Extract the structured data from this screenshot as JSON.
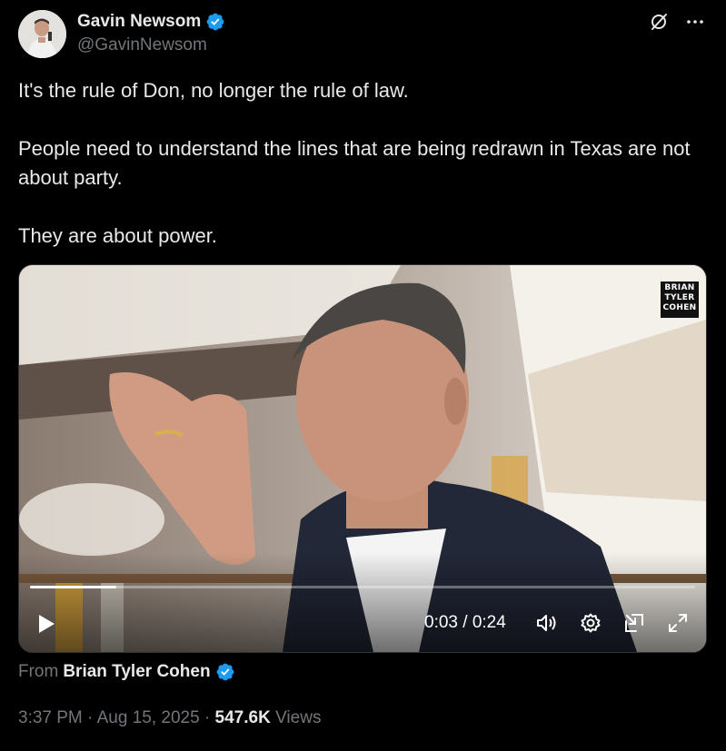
{
  "author": {
    "name": "Gavin Newsom",
    "handle": "@GavinNewsom",
    "verified": true
  },
  "tweet": {
    "paragraphs": [
      "It's the rule of Don, no longer the rule of law.",
      "People need to understand the lines that are being redrawn in Texas are not about party.",
      "They are about power."
    ]
  },
  "video": {
    "watermark": [
      "BRIAN",
      "TYLER",
      "COHEN"
    ],
    "time_display": "0:03 / 0:24",
    "progress_fraction": 0.13,
    "controls": [
      "play-icon",
      "volume-icon",
      "settings-icon",
      "pop-out-icon",
      "fullscreen-icon"
    ]
  },
  "attribution": {
    "prefix": "From",
    "source_name": "Brian Tyler Cohen",
    "verified": true
  },
  "meta": {
    "time": "3:37 PM",
    "sep1": " · ",
    "date": "Aug 15, 2025",
    "sep2": " · ",
    "views_count": "547.6K",
    "views_label": " Views"
  },
  "colors": {
    "background": "#000000",
    "text": "#e7e9ea",
    "secondary": "#71767b",
    "verified": "#1d9bf0"
  }
}
